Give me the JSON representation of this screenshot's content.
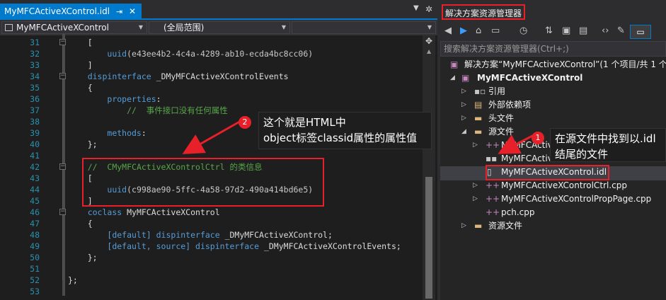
{
  "editor": {
    "tab_label": "MyMFCActiveXControl.idl",
    "tab_pin": "⇥",
    "tab_close": "✕",
    "nav_project": "MyMFCActiveXControl",
    "nav_scope": "(全局范围)",
    "nav_member": "",
    "line_numbers": [
      "31",
      "32",
      "33",
      "34",
      "35",
      "36",
      "37",
      "38",
      "39",
      "40",
      "41",
      "42",
      "43",
      "44",
      "45",
      "46",
      "47",
      "48",
      "49",
      "50",
      "51",
      "52",
      "53"
    ],
    "code": {
      "l31": "[",
      "l32_a": "uuid",
      "l32_b": "(e43ee4b2-4c4a-4289-ab10-ecda4bc8cc06)",
      "l33": "]",
      "l34_kw": "dispinterface",
      "l34_id": " _DMyMFCActiveXControlEvents",
      "l35": "{",
      "l36_kw": "properties",
      "l36_p": ":",
      "l37": "//  事件接口没有任何属性",
      "l38": "",
      "l39_kw": "methods",
      "l39_p": ":",
      "l40": "};",
      "l41": "",
      "l42": "//  CMyMFCActiveXControlCtrl 的类信息",
      "l43": "[",
      "l44_a": "uuid",
      "l44_b": "(c998ae90-5ffc-4a58-97d2-490a414bd6e5)",
      "l45": "]",
      "l46_kw": "coclass",
      "l46_id": " MyMFCActiveXControl",
      "l47": "{",
      "l48_a": "[default]",
      "l48_b": " dispinterface",
      "l48_c": " _DMyMFCActiveXControl;",
      "l49_a": "[default, source]",
      "l49_b": " dispinterface",
      "l49_c": " _DMyMFCActiveXControlEvents;",
      "l50": "};",
      "l51": "",
      "l52": "};",
      "l53": ""
    }
  },
  "annotations": {
    "badge2": "2",
    "callout2_line1": "这个就是HTML中",
    "callout2_line2": "object标签classid属性的属性值",
    "badge1": "1",
    "callout1_line1": "在源文件中找到以.idl",
    "callout1_line2": "结尾的文件"
  },
  "solution_explorer": {
    "title": "解决方案资源管理器",
    "search_placeholder": "搜索解决方案资源管理器(Ctrl+;)",
    "tree": [
      {
        "label": "解决方案“MyMFCActiveXControl”(1 个项目/共 1 个",
        "icon": "solution-icon",
        "level": 0
      },
      {
        "label": "MyMFCActiveXControl",
        "icon": "project-icon",
        "level": 1
      },
      {
        "label": "引用",
        "icon": "references-icon",
        "level": 2
      },
      {
        "label": "外部依赖项",
        "icon": "external-deps-icon",
        "level": 2
      },
      {
        "label": "头文件",
        "icon": "folder-icon",
        "level": 2
      },
      {
        "label": "源文件",
        "icon": "folder-open-icon",
        "level": 2
      },
      {
        "label": "MyMFCActiveXControl.cpp",
        "icon": "cpp-icon",
        "level": 3
      },
      {
        "label": "MyMFCActiveXControl.def",
        "icon": "def-icon",
        "level": 3
      },
      {
        "label": "MyMFCActiveXControl.idl",
        "icon": "idl-icon",
        "level": 3
      },
      {
        "label": "MyMFCActiveXControlCtrl.cpp",
        "icon": "cpp-icon",
        "level": 3
      },
      {
        "label": "MyMFCActiveXControlPropPage.cpp",
        "icon": "cpp-icon",
        "level": 3
      },
      {
        "label": "pch.cpp",
        "icon": "cpp-icon",
        "level": 3
      },
      {
        "label": "资源文件",
        "icon": "folder-icon",
        "level": 2
      }
    ]
  },
  "colors": {
    "accent": "#007acc",
    "annotation_red": "#e8202a",
    "keyword": "#569cd6",
    "comment": "#57a64a",
    "line_number": "#2b91af"
  }
}
